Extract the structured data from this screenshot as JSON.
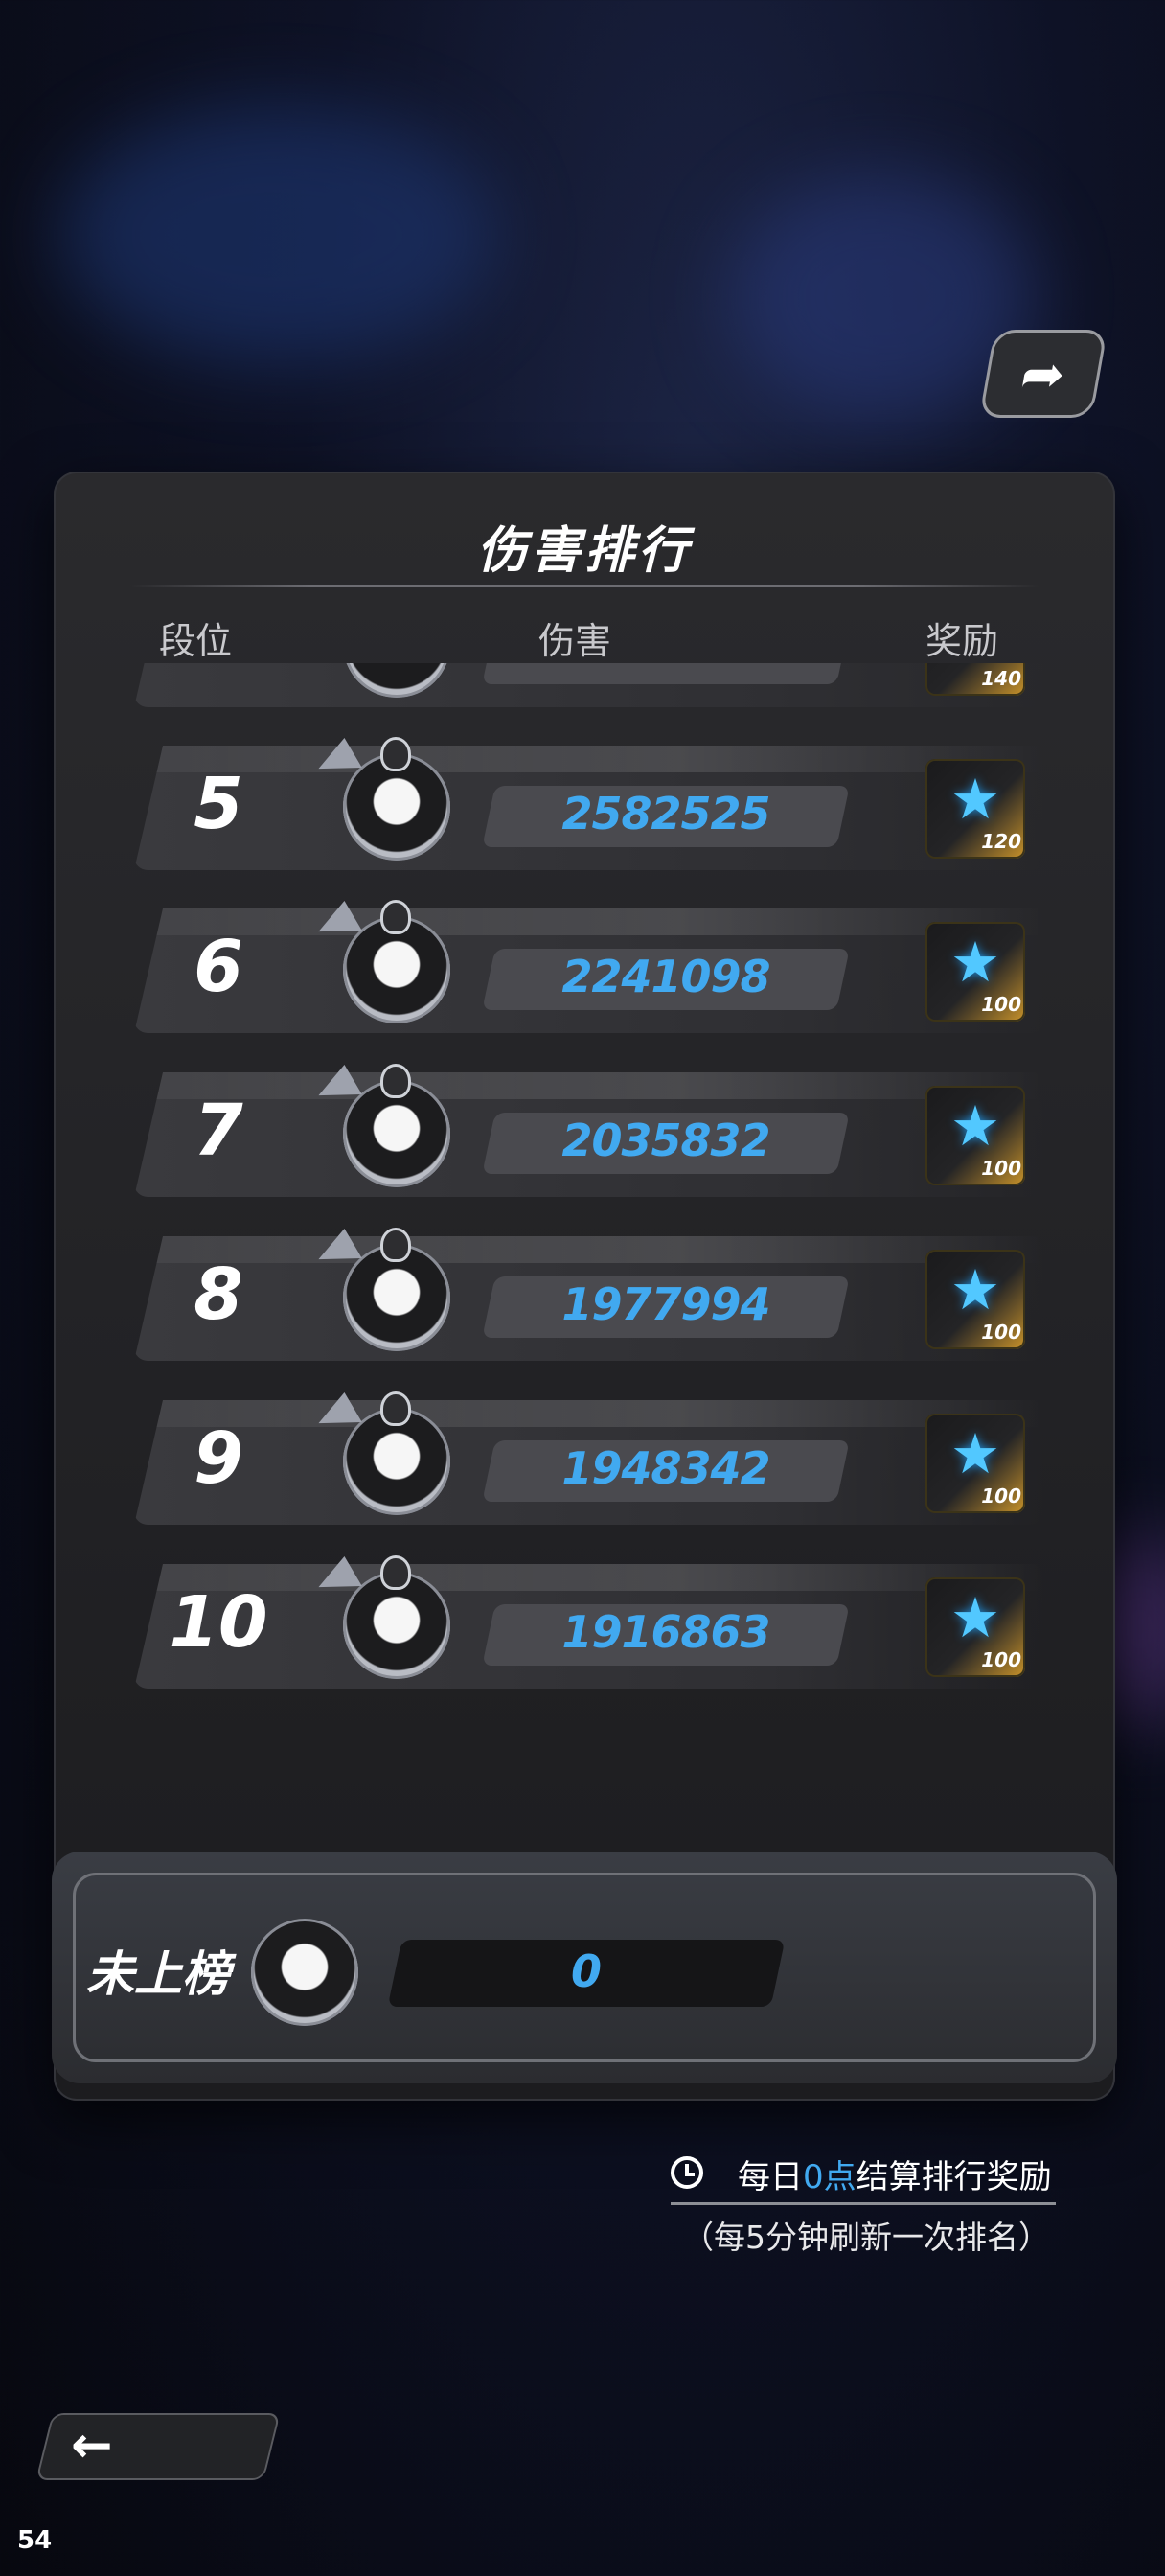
{
  "title": "伤害排行",
  "columns": {
    "rank": "段位",
    "damage": "伤害",
    "reward": "奖励"
  },
  "partial_row": {
    "reward_count": "140"
  },
  "rows": [
    {
      "rank": "5",
      "damage": "2582525",
      "reward_count": "120"
    },
    {
      "rank": "6",
      "damage": "2241098",
      "reward_count": "100"
    },
    {
      "rank": "7",
      "damage": "2035832",
      "reward_count": "100"
    },
    {
      "rank": "8",
      "damage": "1977994",
      "reward_count": "100"
    },
    {
      "rank": "9",
      "damage": "1948342",
      "reward_count": "100"
    },
    {
      "rank": "10",
      "damage": "1916863",
      "reward_count": "100"
    }
  ],
  "self": {
    "label": "未上榜",
    "damage": "0"
  },
  "footer": {
    "settle_prefix": "每日",
    "settle_time": "0点",
    "settle_suffix": "结算排行奖励",
    "refresh_note": "（每5分钟刷新一次排名）"
  },
  "back_arrow": "←",
  "fps": "54",
  "icons": {
    "share": "share-icon",
    "clock": "clock-icon",
    "reward": "star-gem-icon",
    "back": "back-arrow-icon"
  },
  "colors": {
    "accent": "#41a9f0",
    "panel": "#222225",
    "reward_gold": "#c9932a"
  }
}
